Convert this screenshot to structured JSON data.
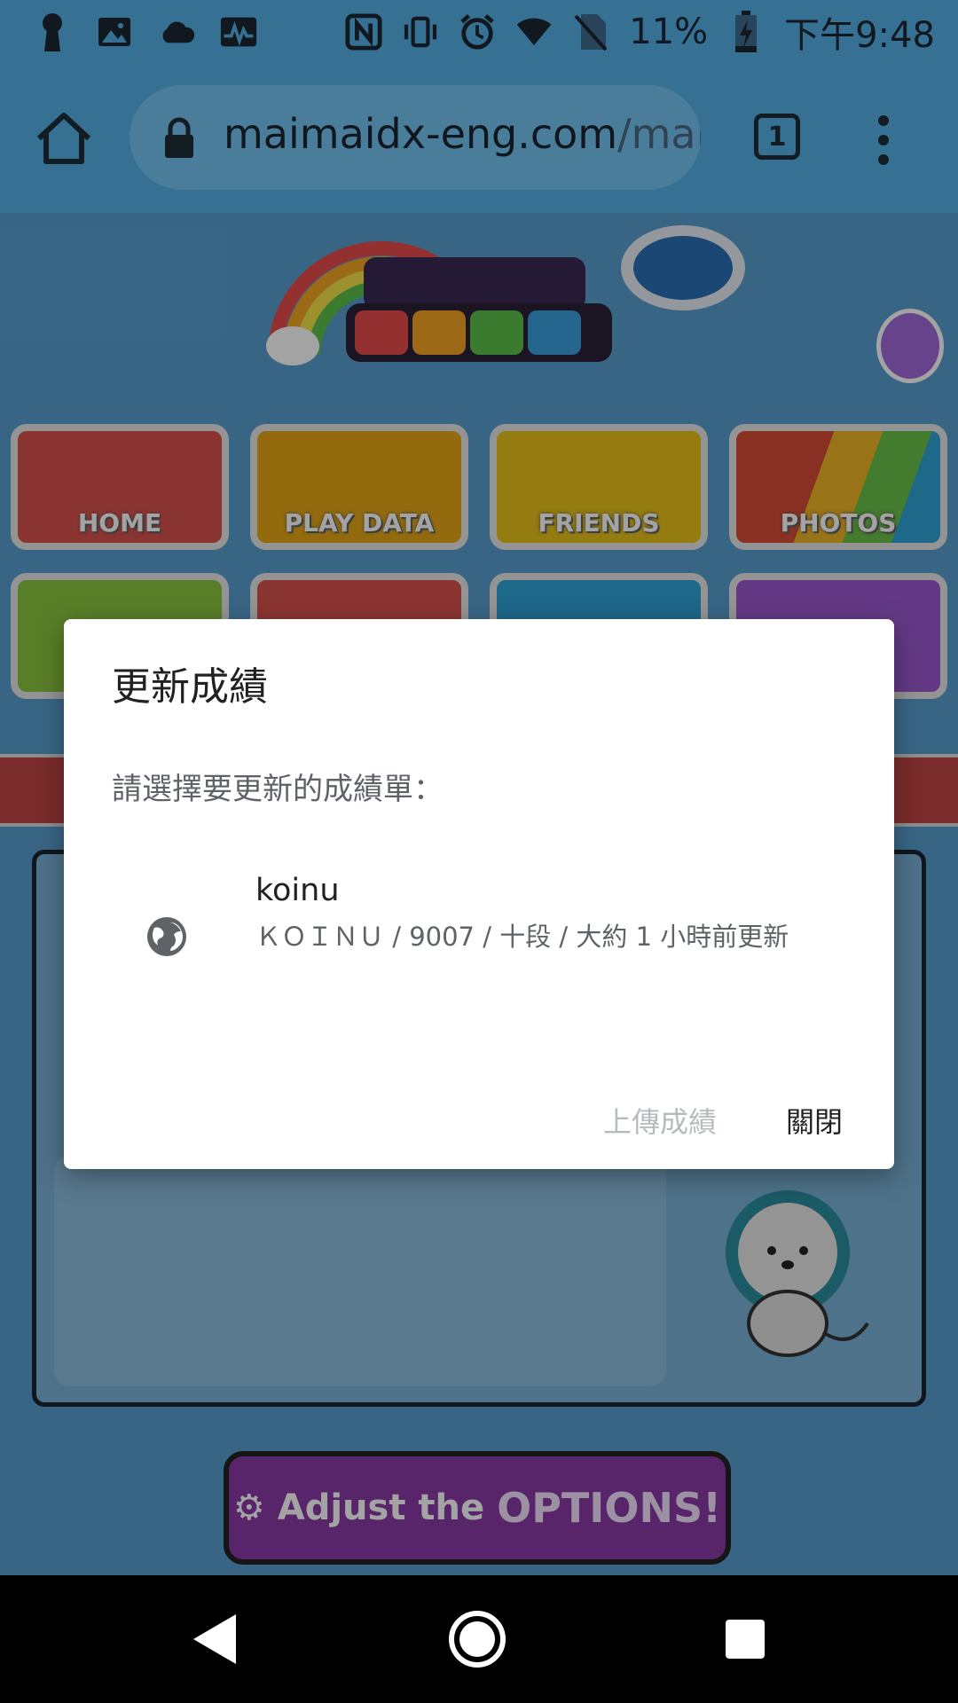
{
  "status_bar": {
    "battery": "11%",
    "time": "下午9:48",
    "icons_left": [
      "keyhole-icon",
      "image-icon",
      "cloud-icon",
      "activity-icon"
    ],
    "icons_right": [
      "nfc-icon",
      "vibrate-icon",
      "alarm-icon",
      "wifi-icon",
      "no-sim-icon",
      "battery-charging-icon"
    ]
  },
  "browser": {
    "url_main": "maimaidx-eng.com",
    "url_path": "/mai",
    "tab_count": "1"
  },
  "site": {
    "menu_tiles": [
      {
        "label": "HOME",
        "color": "#d9534f"
      },
      {
        "label": "PLAY DATA",
        "color": "#e6a817"
      },
      {
        "label": "FRIENDS",
        "color": "#e8c21b"
      },
      {
        "label": "PHOTOS",
        "color": "#d64b36"
      }
    ],
    "options_button": {
      "prefix": "Adjust the",
      "emphasis": "OPTIONS!"
    }
  },
  "dialog": {
    "title": "更新成績",
    "message": "請選擇要更新的成績單：",
    "item": {
      "title": "koinu",
      "subtitle": "ＫＯＩＮＵ / 9007 / 十段 / 大約 1 小時前更新"
    },
    "upload_label": "上傳成績",
    "close_label": "關閉"
  }
}
